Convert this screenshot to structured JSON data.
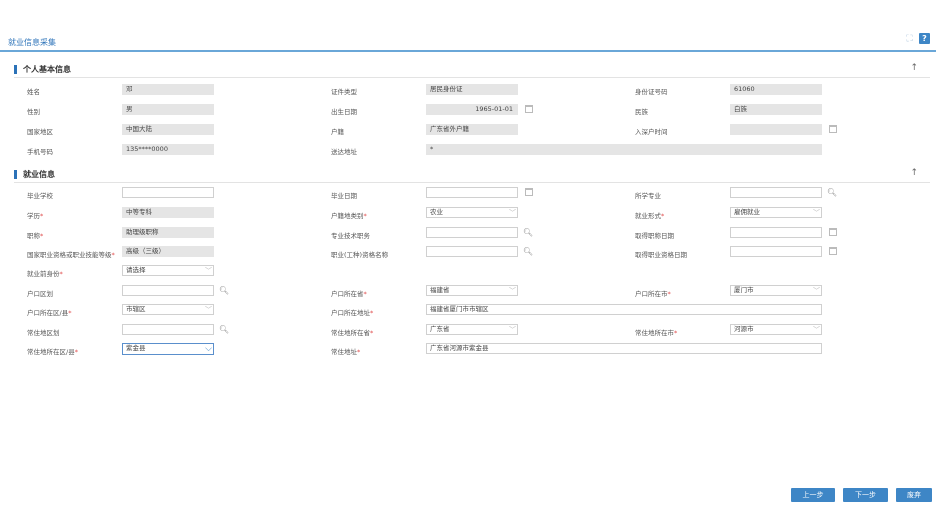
{
  "header": {
    "title": "就业信息采集"
  },
  "section_personal": {
    "title": "个人基本信息",
    "toggle": "↑",
    "fields": {
      "name": {
        "label": "姓名",
        "value": "邓"
      },
      "id_type": {
        "label": "证件类型",
        "value": "居民身份证"
      },
      "id_number": {
        "label": "身份证号码",
        "value": "61060"
      },
      "gender": {
        "label": "性别",
        "value": "男"
      },
      "birth_date": {
        "label": "出生日期",
        "value": "1965-01-01"
      },
      "ethnicity": {
        "label": "民族",
        "value": "白族"
      },
      "country": {
        "label": "国家地区",
        "value": "中国大陆"
      },
      "hukou": {
        "label": "户籍",
        "value": "广东省外户籍"
      },
      "hukou_in_time": {
        "label": "入深户时间",
        "value": ""
      },
      "phone": {
        "label": "手机号码",
        "value": "135****0000"
      },
      "mail_address": {
        "label": "送达地址",
        "value": "*"
      }
    }
  },
  "section_employment": {
    "title": "就业信息",
    "toggle": "↑",
    "fields": {
      "school": {
        "label": "毕业学校",
        "value": ""
      },
      "grad_date": {
        "label": "毕业日期",
        "value": ""
      },
      "major": {
        "label": "所学专业",
        "value": ""
      },
      "education": {
        "label": "学历",
        "value": "中等专科"
      },
      "hukou_type": {
        "label": "户籍地类别",
        "value": "农业"
      },
      "employ_form": {
        "label": "就业形式",
        "value": "雇佣就业"
      },
      "title_rank": {
        "label": "职称",
        "value": "助理级职称"
      },
      "tech_post": {
        "label": "专业技术职务",
        "value": ""
      },
      "title_date": {
        "label": "取得职称日期",
        "value": ""
      },
      "skill_level": {
        "label": "国家职业资格或职业技能等级",
        "value": "高级（三级）"
      },
      "job_cert": {
        "label": "职业(工种)资格名称",
        "value": ""
      },
      "cert_date": {
        "label": "取得职业资格日期",
        "value": ""
      },
      "pre_identity": {
        "label": "就业前身份",
        "value": "请选择"
      },
      "hukou_district": {
        "label": "户口区划",
        "value": ""
      },
      "hukou_province": {
        "label": "户口所在省",
        "value": "福建省"
      },
      "hukou_city": {
        "label": "户口所在市",
        "value": "厦门市"
      },
      "hukou_county": {
        "label": "户口所在区/县",
        "value": "市辖区"
      },
      "hukou_address": {
        "label": "户口所在地址",
        "value": "福建省厦门市市辖区"
      },
      "res_district": {
        "label": "常住地区划",
        "value": ""
      },
      "res_province": {
        "label": "常住地所在省",
        "value": "广东省"
      },
      "res_city": {
        "label": "常住地所在市",
        "value": "河源市"
      },
      "res_county": {
        "label": "常住地所在区/县",
        "value": "紫金县"
      },
      "res_address": {
        "label": "常住地址",
        "value": "广东省河源市紫金县"
      }
    }
  },
  "buttons": {
    "prev": "上一步",
    "next": "下一步",
    "discard": "废弃"
  },
  "colors": {
    "accent": "#3e86c6",
    "title": "#2b72b8",
    "required": "#e04b4b",
    "readonly_bg": "#e5e5e5"
  }
}
